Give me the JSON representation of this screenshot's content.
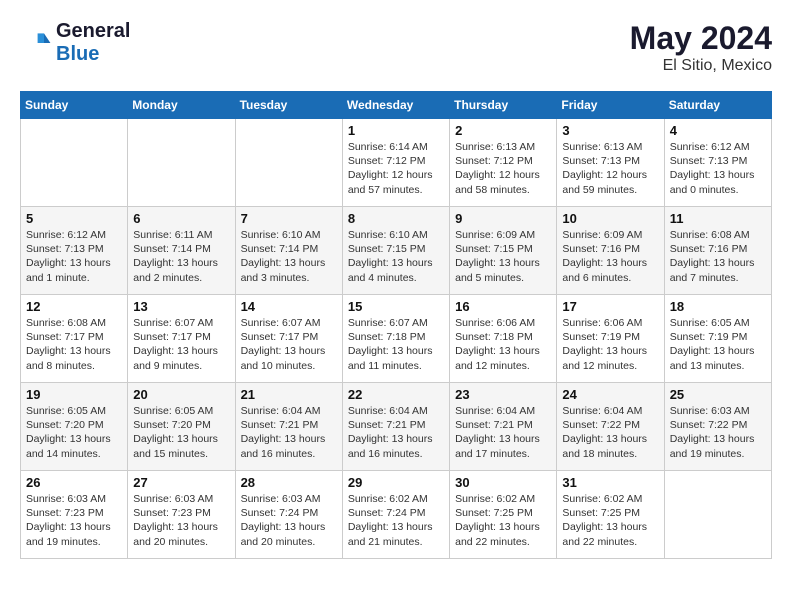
{
  "header": {
    "logo_line1": "General",
    "logo_line2": "Blue",
    "month": "May 2024",
    "location": "El Sitio, Mexico"
  },
  "weekdays": [
    "Sunday",
    "Monday",
    "Tuesday",
    "Wednesday",
    "Thursday",
    "Friday",
    "Saturday"
  ],
  "weeks": [
    [
      {
        "day": "",
        "info": ""
      },
      {
        "day": "",
        "info": ""
      },
      {
        "day": "",
        "info": ""
      },
      {
        "day": "1",
        "info": "Sunrise: 6:14 AM\nSunset: 7:12 PM\nDaylight: 12 hours and 57 minutes."
      },
      {
        "day": "2",
        "info": "Sunrise: 6:13 AM\nSunset: 7:12 PM\nDaylight: 12 hours and 58 minutes."
      },
      {
        "day": "3",
        "info": "Sunrise: 6:13 AM\nSunset: 7:13 PM\nDaylight: 12 hours and 59 minutes."
      },
      {
        "day": "4",
        "info": "Sunrise: 6:12 AM\nSunset: 7:13 PM\nDaylight: 13 hours and 0 minutes."
      }
    ],
    [
      {
        "day": "5",
        "info": "Sunrise: 6:12 AM\nSunset: 7:13 PM\nDaylight: 13 hours and 1 minute."
      },
      {
        "day": "6",
        "info": "Sunrise: 6:11 AM\nSunset: 7:14 PM\nDaylight: 13 hours and 2 minutes."
      },
      {
        "day": "7",
        "info": "Sunrise: 6:10 AM\nSunset: 7:14 PM\nDaylight: 13 hours and 3 minutes."
      },
      {
        "day": "8",
        "info": "Sunrise: 6:10 AM\nSunset: 7:15 PM\nDaylight: 13 hours and 4 minutes."
      },
      {
        "day": "9",
        "info": "Sunrise: 6:09 AM\nSunset: 7:15 PM\nDaylight: 13 hours and 5 minutes."
      },
      {
        "day": "10",
        "info": "Sunrise: 6:09 AM\nSunset: 7:16 PM\nDaylight: 13 hours and 6 minutes."
      },
      {
        "day": "11",
        "info": "Sunrise: 6:08 AM\nSunset: 7:16 PM\nDaylight: 13 hours and 7 minutes."
      }
    ],
    [
      {
        "day": "12",
        "info": "Sunrise: 6:08 AM\nSunset: 7:17 PM\nDaylight: 13 hours and 8 minutes."
      },
      {
        "day": "13",
        "info": "Sunrise: 6:07 AM\nSunset: 7:17 PM\nDaylight: 13 hours and 9 minutes."
      },
      {
        "day": "14",
        "info": "Sunrise: 6:07 AM\nSunset: 7:17 PM\nDaylight: 13 hours and 10 minutes."
      },
      {
        "day": "15",
        "info": "Sunrise: 6:07 AM\nSunset: 7:18 PM\nDaylight: 13 hours and 11 minutes."
      },
      {
        "day": "16",
        "info": "Sunrise: 6:06 AM\nSunset: 7:18 PM\nDaylight: 13 hours and 12 minutes."
      },
      {
        "day": "17",
        "info": "Sunrise: 6:06 AM\nSunset: 7:19 PM\nDaylight: 13 hours and 12 minutes."
      },
      {
        "day": "18",
        "info": "Sunrise: 6:05 AM\nSunset: 7:19 PM\nDaylight: 13 hours and 13 minutes."
      }
    ],
    [
      {
        "day": "19",
        "info": "Sunrise: 6:05 AM\nSunset: 7:20 PM\nDaylight: 13 hours and 14 minutes."
      },
      {
        "day": "20",
        "info": "Sunrise: 6:05 AM\nSunset: 7:20 PM\nDaylight: 13 hours and 15 minutes."
      },
      {
        "day": "21",
        "info": "Sunrise: 6:04 AM\nSunset: 7:21 PM\nDaylight: 13 hours and 16 minutes."
      },
      {
        "day": "22",
        "info": "Sunrise: 6:04 AM\nSunset: 7:21 PM\nDaylight: 13 hours and 16 minutes."
      },
      {
        "day": "23",
        "info": "Sunrise: 6:04 AM\nSunset: 7:21 PM\nDaylight: 13 hours and 17 minutes."
      },
      {
        "day": "24",
        "info": "Sunrise: 6:04 AM\nSunset: 7:22 PM\nDaylight: 13 hours and 18 minutes."
      },
      {
        "day": "25",
        "info": "Sunrise: 6:03 AM\nSunset: 7:22 PM\nDaylight: 13 hours and 19 minutes."
      }
    ],
    [
      {
        "day": "26",
        "info": "Sunrise: 6:03 AM\nSunset: 7:23 PM\nDaylight: 13 hours and 19 minutes."
      },
      {
        "day": "27",
        "info": "Sunrise: 6:03 AM\nSunset: 7:23 PM\nDaylight: 13 hours and 20 minutes."
      },
      {
        "day": "28",
        "info": "Sunrise: 6:03 AM\nSunset: 7:24 PM\nDaylight: 13 hours and 20 minutes."
      },
      {
        "day": "29",
        "info": "Sunrise: 6:02 AM\nSunset: 7:24 PM\nDaylight: 13 hours and 21 minutes."
      },
      {
        "day": "30",
        "info": "Sunrise: 6:02 AM\nSunset: 7:25 PM\nDaylight: 13 hours and 22 minutes."
      },
      {
        "day": "31",
        "info": "Sunrise: 6:02 AM\nSunset: 7:25 PM\nDaylight: 13 hours and 22 minutes."
      },
      {
        "day": "",
        "info": ""
      }
    ]
  ]
}
